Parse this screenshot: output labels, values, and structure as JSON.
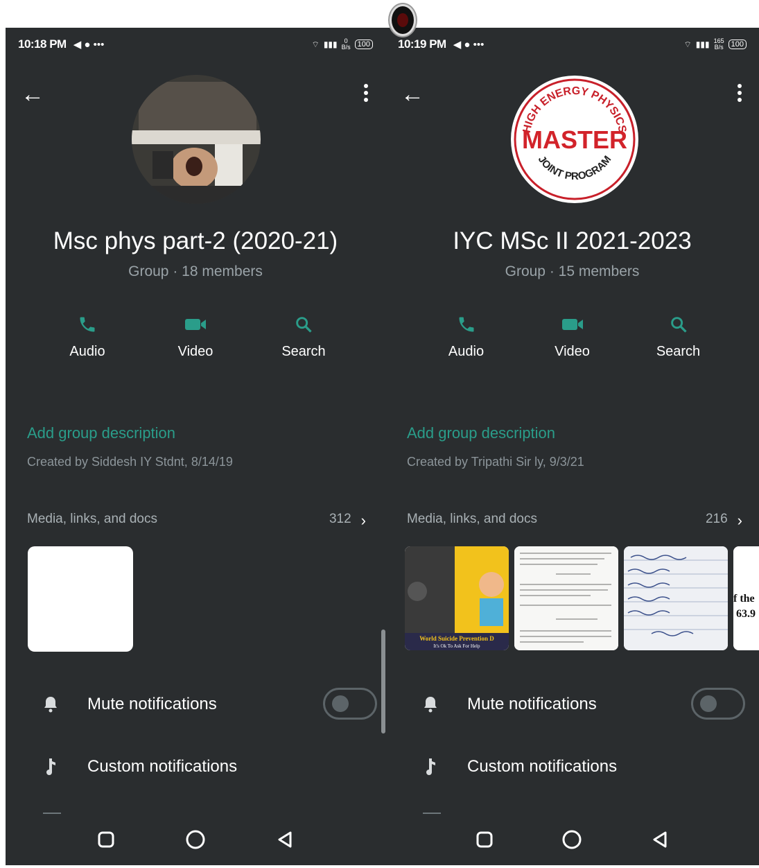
{
  "left": {
    "status": {
      "time": "10:18 PM",
      "left_icons": "◀ ● •••",
      "battery": "100",
      "net_top": "0",
      "net_bottom": "B/s"
    },
    "group_name": "Msc phys part-2 (2020-21)",
    "group_meta": "Group · 18 members",
    "actions": [
      {
        "label": "Audio"
      },
      {
        "label": "Video"
      },
      {
        "label": "Search"
      }
    ],
    "description_link": "Add group description",
    "created_by": "Created by Siddesh IY Stdnt, 8/14/19",
    "media": {
      "label": "Media, links, and docs",
      "count": "312"
    },
    "settings": {
      "mute": "Mute notifications",
      "custom": "Custom notifications"
    },
    "mute_on": false
  },
  "right": {
    "status": {
      "time": "10:19 PM",
      "left_icons": "◀ ● •••",
      "battery": "100",
      "net_top": "165",
      "net_bottom": "B/s"
    },
    "group_name": "IYC MSc II 2021-2023",
    "group_meta": "Group · 15 members",
    "logo": {
      "top_text": "HIGH ENERGY PHYSICS",
      "middle": "MASTER",
      "bottom_text": "JOINT PROGRAM"
    },
    "actions": [
      {
        "label": "Audio"
      },
      {
        "label": "Video"
      },
      {
        "label": "Search"
      }
    ],
    "description_link": "Add group description",
    "created_by": "Created by Tripathi Sir ly, 9/3/21",
    "media": {
      "label": "Media, links, and docs",
      "count": "216"
    },
    "thumb1": {
      "caption": "World Suicide Prevention D",
      "sub": "It's Ok To Ask For Help"
    },
    "thumb4": {
      "line1": "f the",
      "line2": "63.9"
    },
    "settings": {
      "mute": "Mute notifications",
      "custom": "Custom notifications"
    },
    "mute_on": false
  },
  "colors": {
    "accent": "#2a9d8a",
    "background": "#2a2d2f"
  }
}
